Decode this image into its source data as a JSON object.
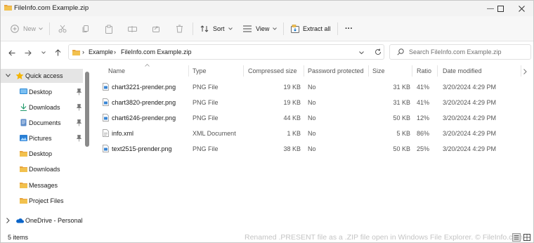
{
  "window": {
    "title": "FileInfo.com Example.zip",
    "controls": {
      "minimize": "—",
      "maximize": "☐",
      "close": "✕"
    }
  },
  "toolbar": {
    "new_label": "New",
    "sort_label": "Sort",
    "view_label": "View",
    "extract_all_label": "Extract all",
    "more_label": "···"
  },
  "address": {
    "segments": [
      "Example",
      "FileInfo.com Example.zip"
    ],
    "separator": "›"
  },
  "search": {
    "placeholder": "Search FileInfo.com Example.zip"
  },
  "sidebar": {
    "items": [
      {
        "label": "Quick access",
        "icon": "star-icon"
      },
      {
        "label": "Desktop",
        "icon": "desktop-icon",
        "pinned": true
      },
      {
        "label": "Downloads",
        "icon": "download-icon",
        "pinned": true
      },
      {
        "label": "Documents",
        "icon": "documents-icon",
        "pinned": true
      },
      {
        "label": "Pictures",
        "icon": "pictures-icon",
        "pinned": true
      },
      {
        "label": "Desktop",
        "icon": "folder-icon"
      },
      {
        "label": "Downloads",
        "icon": "folder-icon"
      },
      {
        "label": "Messages",
        "icon": "folder-icon"
      },
      {
        "label": "Project Files",
        "icon": "folder-icon"
      },
      {
        "label": "OneDrive - Personal",
        "icon": "cloud-icon"
      }
    ]
  },
  "columns": [
    "Name",
    "Type",
    "Compressed size",
    "Password protected",
    "Size",
    "Ratio",
    "Date modified"
  ],
  "files": [
    {
      "name": "chart3221-prender.png",
      "type": "PNG File",
      "compressed": "19 KB",
      "protected": "No",
      "size": "31 KB",
      "ratio": "41%",
      "modified": "3/20/2024 4:29 PM",
      "icon": "image-file-icon"
    },
    {
      "name": "chart3820-prender.png",
      "type": "PNG File",
      "compressed": "19 KB",
      "protected": "No",
      "size": "31 KB",
      "ratio": "41%",
      "modified": "3/20/2024 4:29 PM",
      "icon": "image-file-icon"
    },
    {
      "name": "chart6246-prender.png",
      "type": "PNG File",
      "compressed": "44 KB",
      "protected": "No",
      "size": "50 KB",
      "ratio": "12%",
      "modified": "3/20/2024 4:29 PM",
      "icon": "image-file-icon"
    },
    {
      "name": "info.xml",
      "type": "XML Document",
      "compressed": "1 KB",
      "protected": "No",
      "size": "5 KB",
      "ratio": "86%",
      "modified": "3/20/2024 4:29 PM",
      "icon": "xml-file-icon"
    },
    {
      "name": "text2515-prender.png",
      "type": "PNG File",
      "compressed": "38 KB",
      "protected": "No",
      "size": "50 KB",
      "ratio": "25%",
      "modified": "3/20/2024 4:29 PM",
      "icon": "image-file-icon"
    }
  ],
  "status": {
    "item_count": "5 items",
    "watermark": "Renamed .PRESENT file as a .ZIP file open in Windows File Explorer. © FileInfo.com"
  },
  "colors": {
    "folder": "#f2c14e",
    "accent": "#0067c0",
    "selected": "#e5e5e5",
    "star": "#f4b400"
  }
}
